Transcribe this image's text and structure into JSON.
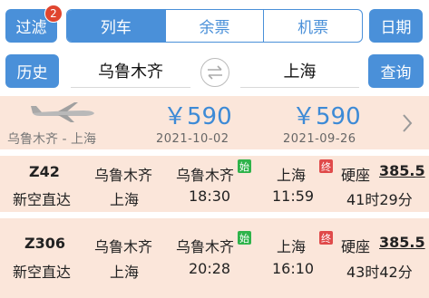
{
  "toolbar": {
    "filter_label": "过滤",
    "filter_badge": "2",
    "tabs": [
      "列车",
      "余票",
      "机票"
    ],
    "date_label": "日期"
  },
  "search": {
    "history_label": "历史",
    "from": "乌鲁木齐",
    "to": "上海",
    "query_label": "查询"
  },
  "flight": {
    "route": "乌鲁木齐 - 上海",
    "prices": [
      {
        "price": "￥590",
        "date": "2021-10-02"
      },
      {
        "price": "￥590",
        "date": "2021-09-26"
      }
    ]
  },
  "trains": [
    {
      "number": "Z42",
      "type": "新空直达",
      "origin": "乌鲁木齐",
      "destination": "上海",
      "depart_station": "乌鲁木齐",
      "depart_time": "18:30",
      "arrive_station": "上海",
      "arrive_time": "11:59",
      "start_tag": "始",
      "end_tag": "终",
      "seat": "硬座",
      "seat_price": "385.5",
      "duration": "41时29分"
    },
    {
      "number": "Z306",
      "type": "新空直达",
      "origin": "乌鲁木齐",
      "destination": "上海",
      "depart_station": "乌鲁木齐",
      "depart_time": "20:28",
      "arrive_station": "上海",
      "arrive_time": "16:10",
      "start_tag": "始",
      "end_tag": "终",
      "seat": "硬座",
      "seat_price": "385.5",
      "duration": "43时42分"
    }
  ],
  "colors": {
    "accent": "#4a90d9",
    "card_bg": "#fbe6da",
    "price_blue": "#3d8ad6",
    "seat_price": "#9c2b5a",
    "badge": "#e0452f"
  }
}
